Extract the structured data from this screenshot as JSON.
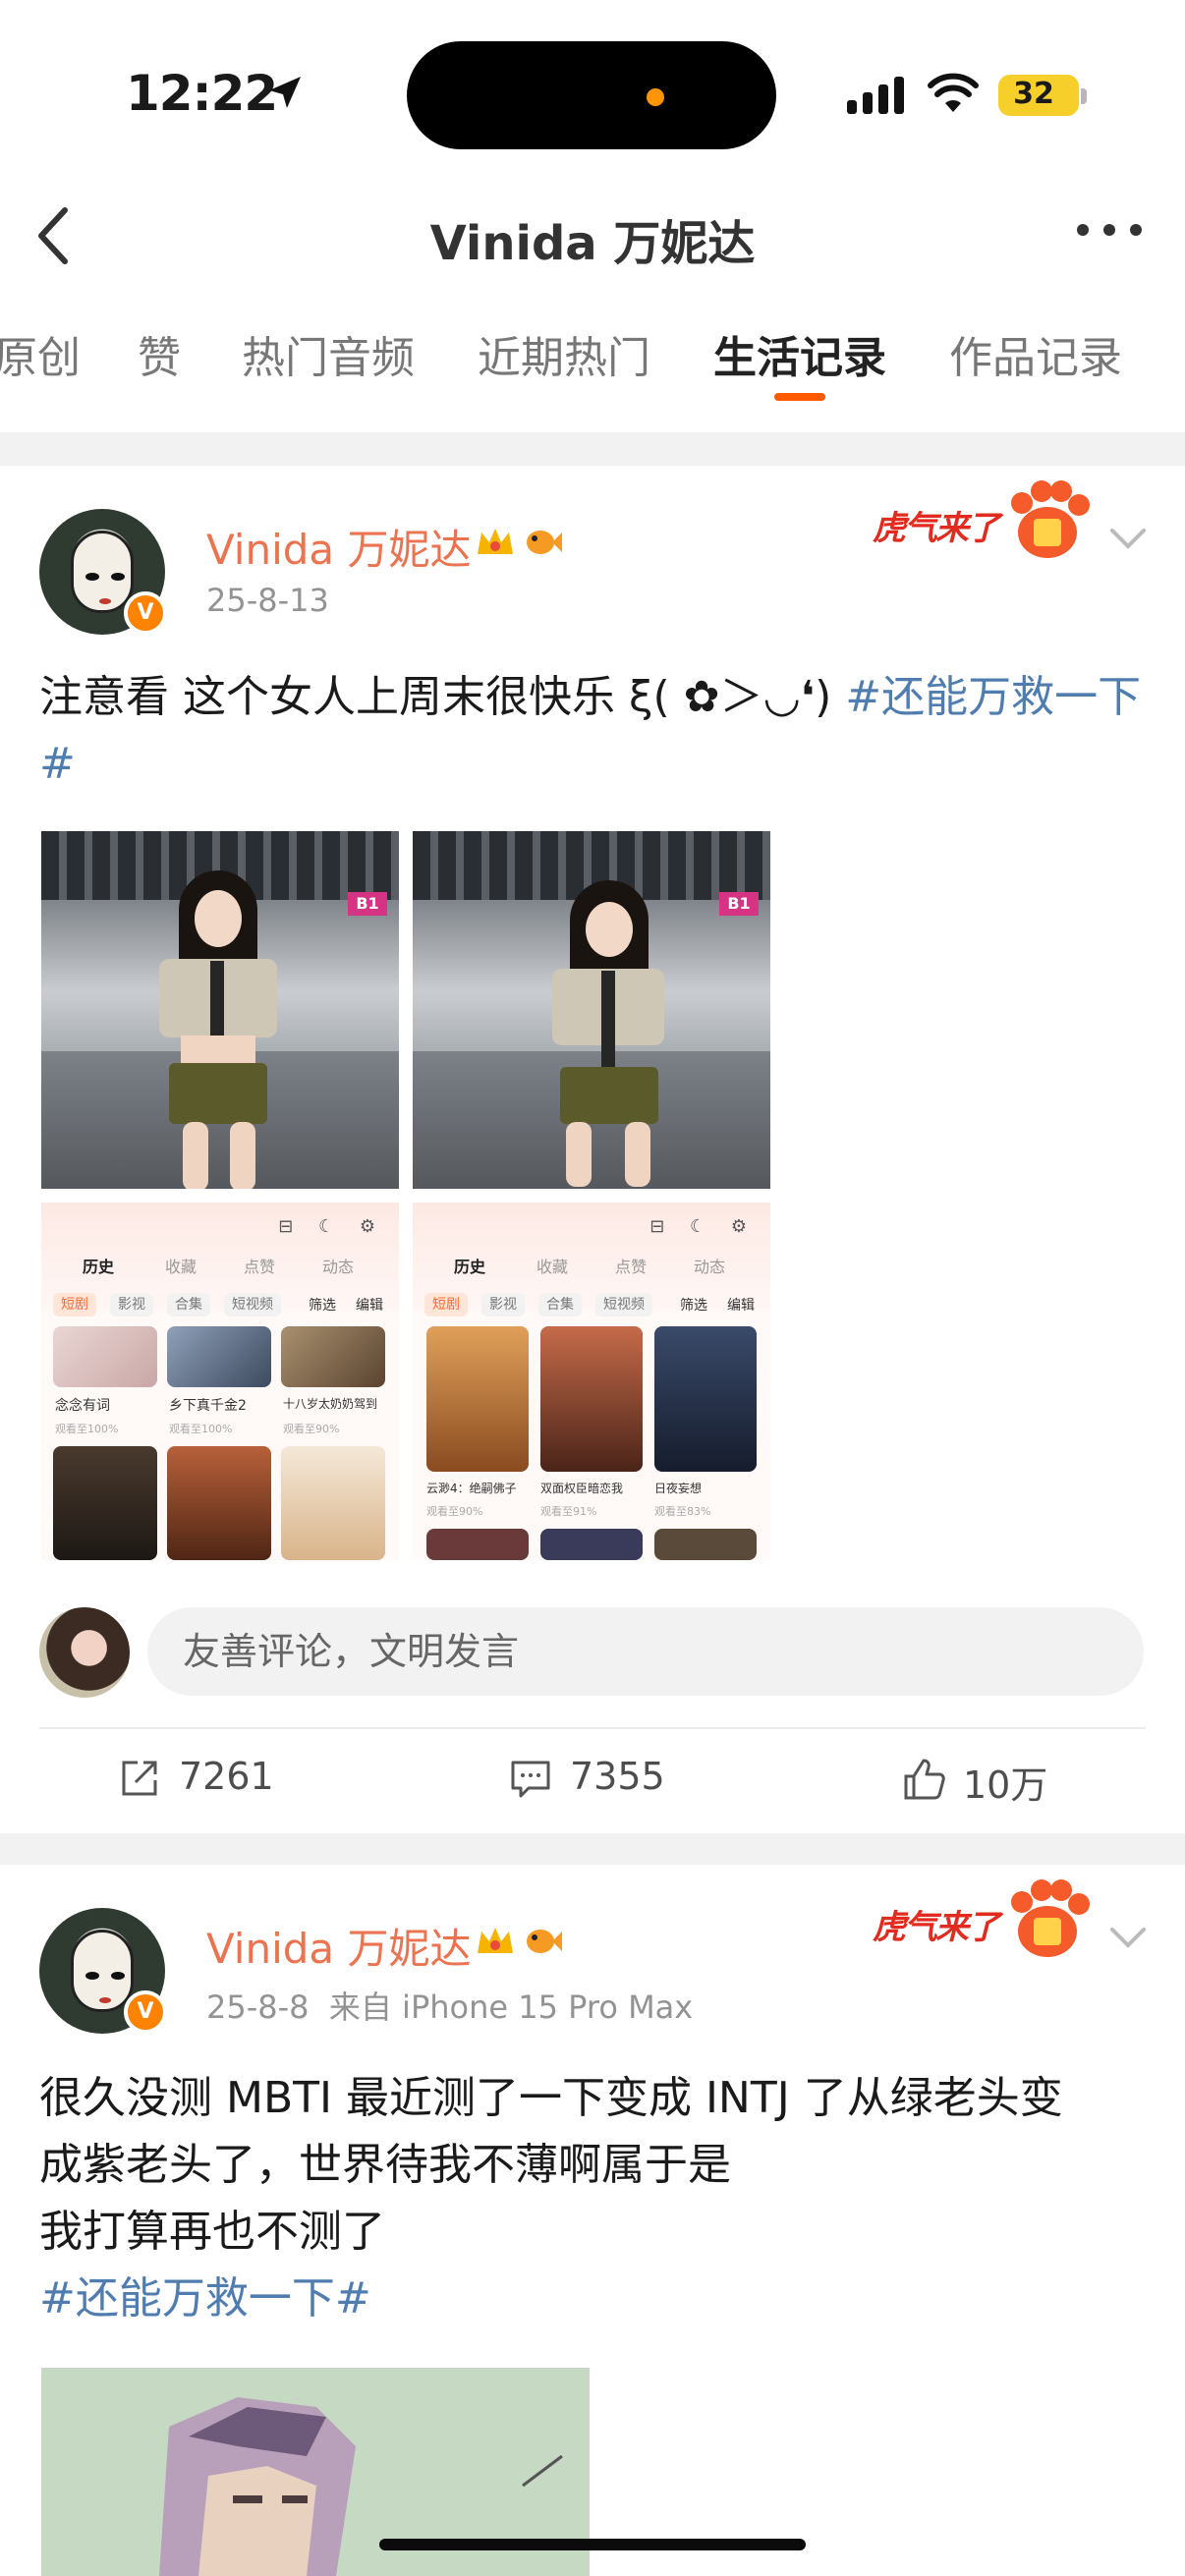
{
  "status_bar": {
    "time": "12:22",
    "battery": "32"
  },
  "nav": {
    "title": "Vinida 万妮达"
  },
  "tabs": [
    {
      "label": "原创",
      "active": false
    },
    {
      "label": "赞",
      "active": false
    },
    {
      "label": "热门音频",
      "active": false
    },
    {
      "label": "近期热门",
      "active": false
    },
    {
      "label": "生活记录",
      "active": true
    },
    {
      "label": "作品记录",
      "active": false
    }
  ],
  "posts": [
    {
      "username": "Vinida 万妮达",
      "date": "25-8-13",
      "source": "",
      "sticker": "虎气来了",
      "text_prefix": "注意看 这个女人上周末很快乐 ξ( ✿＞◡❛) ",
      "hashtag": "#还能万救一下#",
      "app_screens": [
        {
          "tabs": [
            "历史",
            "收藏",
            "点赞",
            "动态"
          ],
          "chips": [
            "短剧",
            "影视",
            "合集",
            "短视频"
          ],
          "actions": [
            "筛选",
            "编辑"
          ],
          "shows": [
            {
              "title": "念念有词",
              "sub": "观看至100%"
            },
            {
              "title": "乡下真千金2",
              "sub": "观看至100%"
            },
            {
              "title": "十八岁太奶奶驾到",
              "sub": "观看至90%"
            }
          ]
        },
        {
          "tabs": [
            "历史",
            "收藏",
            "点赞",
            "动态"
          ],
          "chips": [
            "短剧",
            "影视",
            "合集",
            "短视频"
          ],
          "actions": [
            "筛选",
            "编辑"
          ],
          "shows": [
            {
              "title": "云渺4：绝嗣佛子",
              "sub": "观看至90%"
            },
            {
              "title": "双面权臣暗恋我",
              "sub": "观看至91%"
            },
            {
              "title": "日夜妄想",
              "sub": "观看至83%"
            }
          ]
        }
      ],
      "comment_placeholder": "友善评论，文明发言",
      "reposts": "7261",
      "comments": "7355",
      "likes": "10万"
    },
    {
      "username": "Vinida 万妮达",
      "date": "25-8-8",
      "source": "来自 iPhone 15 Pro Max",
      "sticker": "虎气来了",
      "lines": [
        "很久没测 MBTI 最近测了一下变成 INTJ 了从绿老头变",
        "成紫老头了，世界待我不薄啊属于是",
        "我打算再也不测了"
      ],
      "hashtag": "#还能万救一下#"
    }
  ],
  "colors": {
    "accent": "#ff5a00",
    "username": "#eb7350",
    "hashtag": "#507daf",
    "vip": "#ff8200"
  }
}
